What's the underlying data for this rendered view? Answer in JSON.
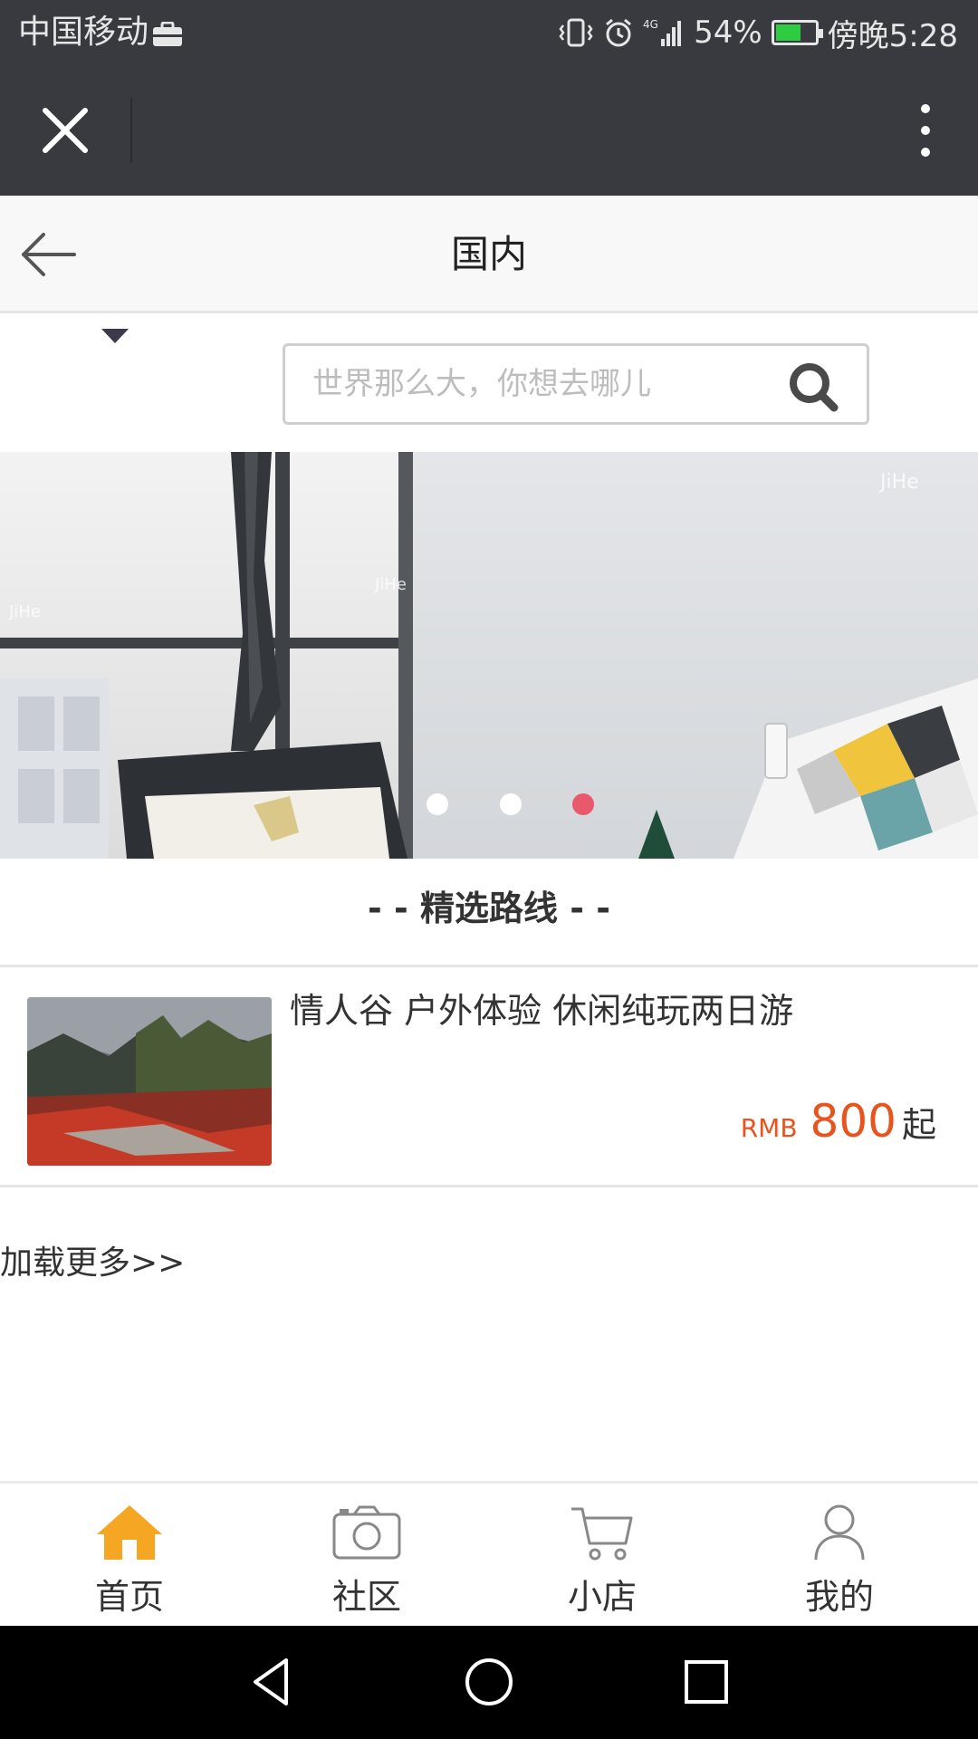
{
  "status_bar": {
    "carrier": "中国移动",
    "battery": "54%",
    "time": "傍晚5:28",
    "network": "4G"
  },
  "header": {
    "title": "国内"
  },
  "search": {
    "placeholder": "世界那么大，你想去哪儿"
  },
  "banner": {
    "watermark": "JiHe",
    "active_index": 2,
    "count": 3
  },
  "section": {
    "title": "- - 精选路线 - -"
  },
  "routes": [
    {
      "title": "情人谷 户外体验 休闲纯玩两日游",
      "currency": "RMB",
      "price": "800",
      "suffix": "起"
    }
  ],
  "load_more": "加载更多>>",
  "tabs": [
    {
      "label": "首页",
      "icon": "home-icon",
      "active": true
    },
    {
      "label": "社区",
      "icon": "camera-icon",
      "active": false
    },
    {
      "label": "小店",
      "icon": "cart-icon",
      "active": false
    },
    {
      "label": "我的",
      "icon": "user-icon",
      "active": false
    }
  ],
  "colors": {
    "accent": "#f5a623",
    "price": "#e8541e",
    "active_dot": "#e8596b",
    "topbar": "#393a3f"
  }
}
